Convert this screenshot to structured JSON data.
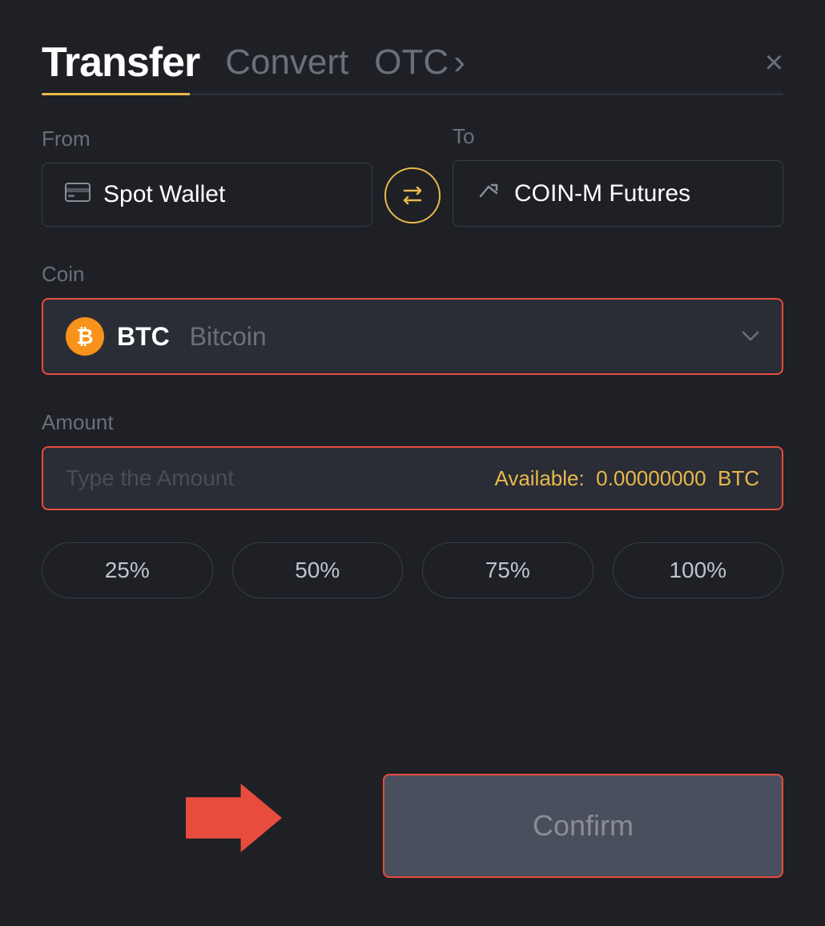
{
  "header": {
    "title": "Transfer",
    "tab_convert": "Convert",
    "tab_otc": "OTC",
    "tab_otc_arrow": "›",
    "close_label": "×"
  },
  "from": {
    "label": "From",
    "wallet_icon": "💳",
    "wallet_name": "Spot Wallet"
  },
  "to": {
    "label": "To",
    "futures_icon": "↑",
    "wallet_name": "COIN-M Futures"
  },
  "swap": {
    "icon": "⇄"
  },
  "coin": {
    "label": "Coin",
    "symbol": "BTC",
    "name": "Bitcoin",
    "icon_letter": "₿"
  },
  "amount": {
    "label": "Amount",
    "placeholder": "Type the Amount",
    "available_label": "Available:",
    "available_value": "0.00000000",
    "available_currency": "BTC"
  },
  "percentages": [
    {
      "label": "25%"
    },
    {
      "label": "50%"
    },
    {
      "label": "75%"
    },
    {
      "label": "100%"
    }
  ],
  "confirm_button": {
    "label": "Confirm"
  },
  "colors": {
    "accent": "#e8b84b",
    "danger": "#e74c3c",
    "bg_dark": "#1e2026",
    "text_muted": "#6b6f78"
  }
}
